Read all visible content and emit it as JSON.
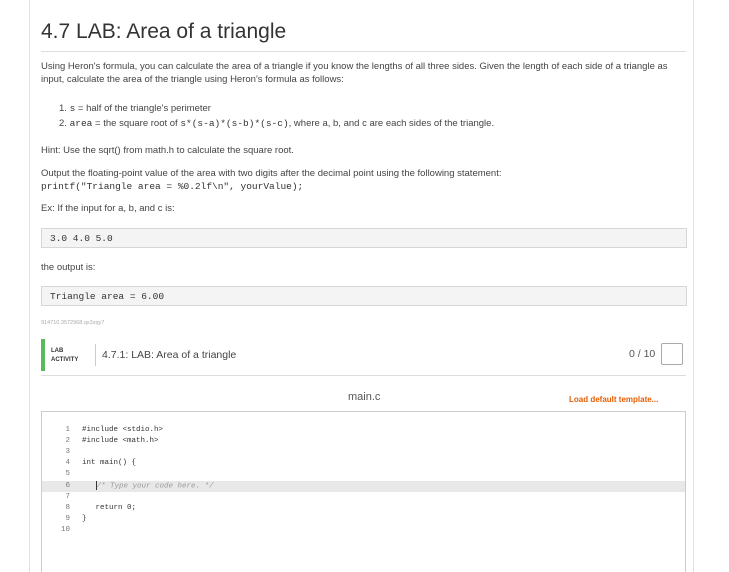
{
  "page": {
    "title": "4.7 LAB: Area of a triangle",
    "intro": "Using Heron's formula, you can calculate the area of a triangle if you know the lengths of all three sides. Given the length of each side of a triangle as input, calculate the area of the triangle using Heron's formula as follows:",
    "steps": [
      {
        "num": "1.",
        "code": "s",
        "text": " = half of the triangle's perimeter"
      },
      {
        "num": "2.",
        "code": "area",
        "text_a": " = the square root of ",
        "code2": "s*(s-a)*(s-b)*(s-c)",
        "text_b": ", where a, b, and c are each sides of the triangle."
      }
    ],
    "hint": "Hint: Use the sqrt() from math.h to calculate the square root.",
    "output_intro": "Output the floating-point value of the area with two digits after the decimal point using the following statement:",
    "printf": "printf(\"Triangle area = %0.2lf\\n\", yourValue);",
    "example_intro": "Ex: If the input for a, b, and c is:",
    "example_input": "3.0 4.0 5.0",
    "output_label": "the output is:",
    "example_output": "Triangle area = 6.00",
    "tiny_id": "914710.3572968.qx3zqy7"
  },
  "lab": {
    "tag_line1": "LAB",
    "tag_line2": "ACTIVITY",
    "name": "4.7.1: LAB: Area of a triangle",
    "score": "0 / 10"
  },
  "editor": {
    "file_name": "main.c",
    "load_default": "Load default template...",
    "lines": [
      {
        "n": "1",
        "code": "#include <stdio.h>"
      },
      {
        "n": "2",
        "code": "#include <math.h>"
      },
      {
        "n": "3",
        "code": ""
      },
      {
        "n": "4",
        "code": "int main() {"
      },
      {
        "n": "5",
        "code": ""
      },
      {
        "n": "6",
        "code": "   /* Type your code here. */",
        "comment": true,
        "active": true
      },
      {
        "n": "7",
        "code": ""
      },
      {
        "n": "8",
        "code": "   return 0;"
      },
      {
        "n": "9",
        "code": "}"
      },
      {
        "n": "10",
        "code": ""
      }
    ]
  },
  "colors": {
    "accent_green": "#5cb85c",
    "link_orange": "#e65c00"
  }
}
